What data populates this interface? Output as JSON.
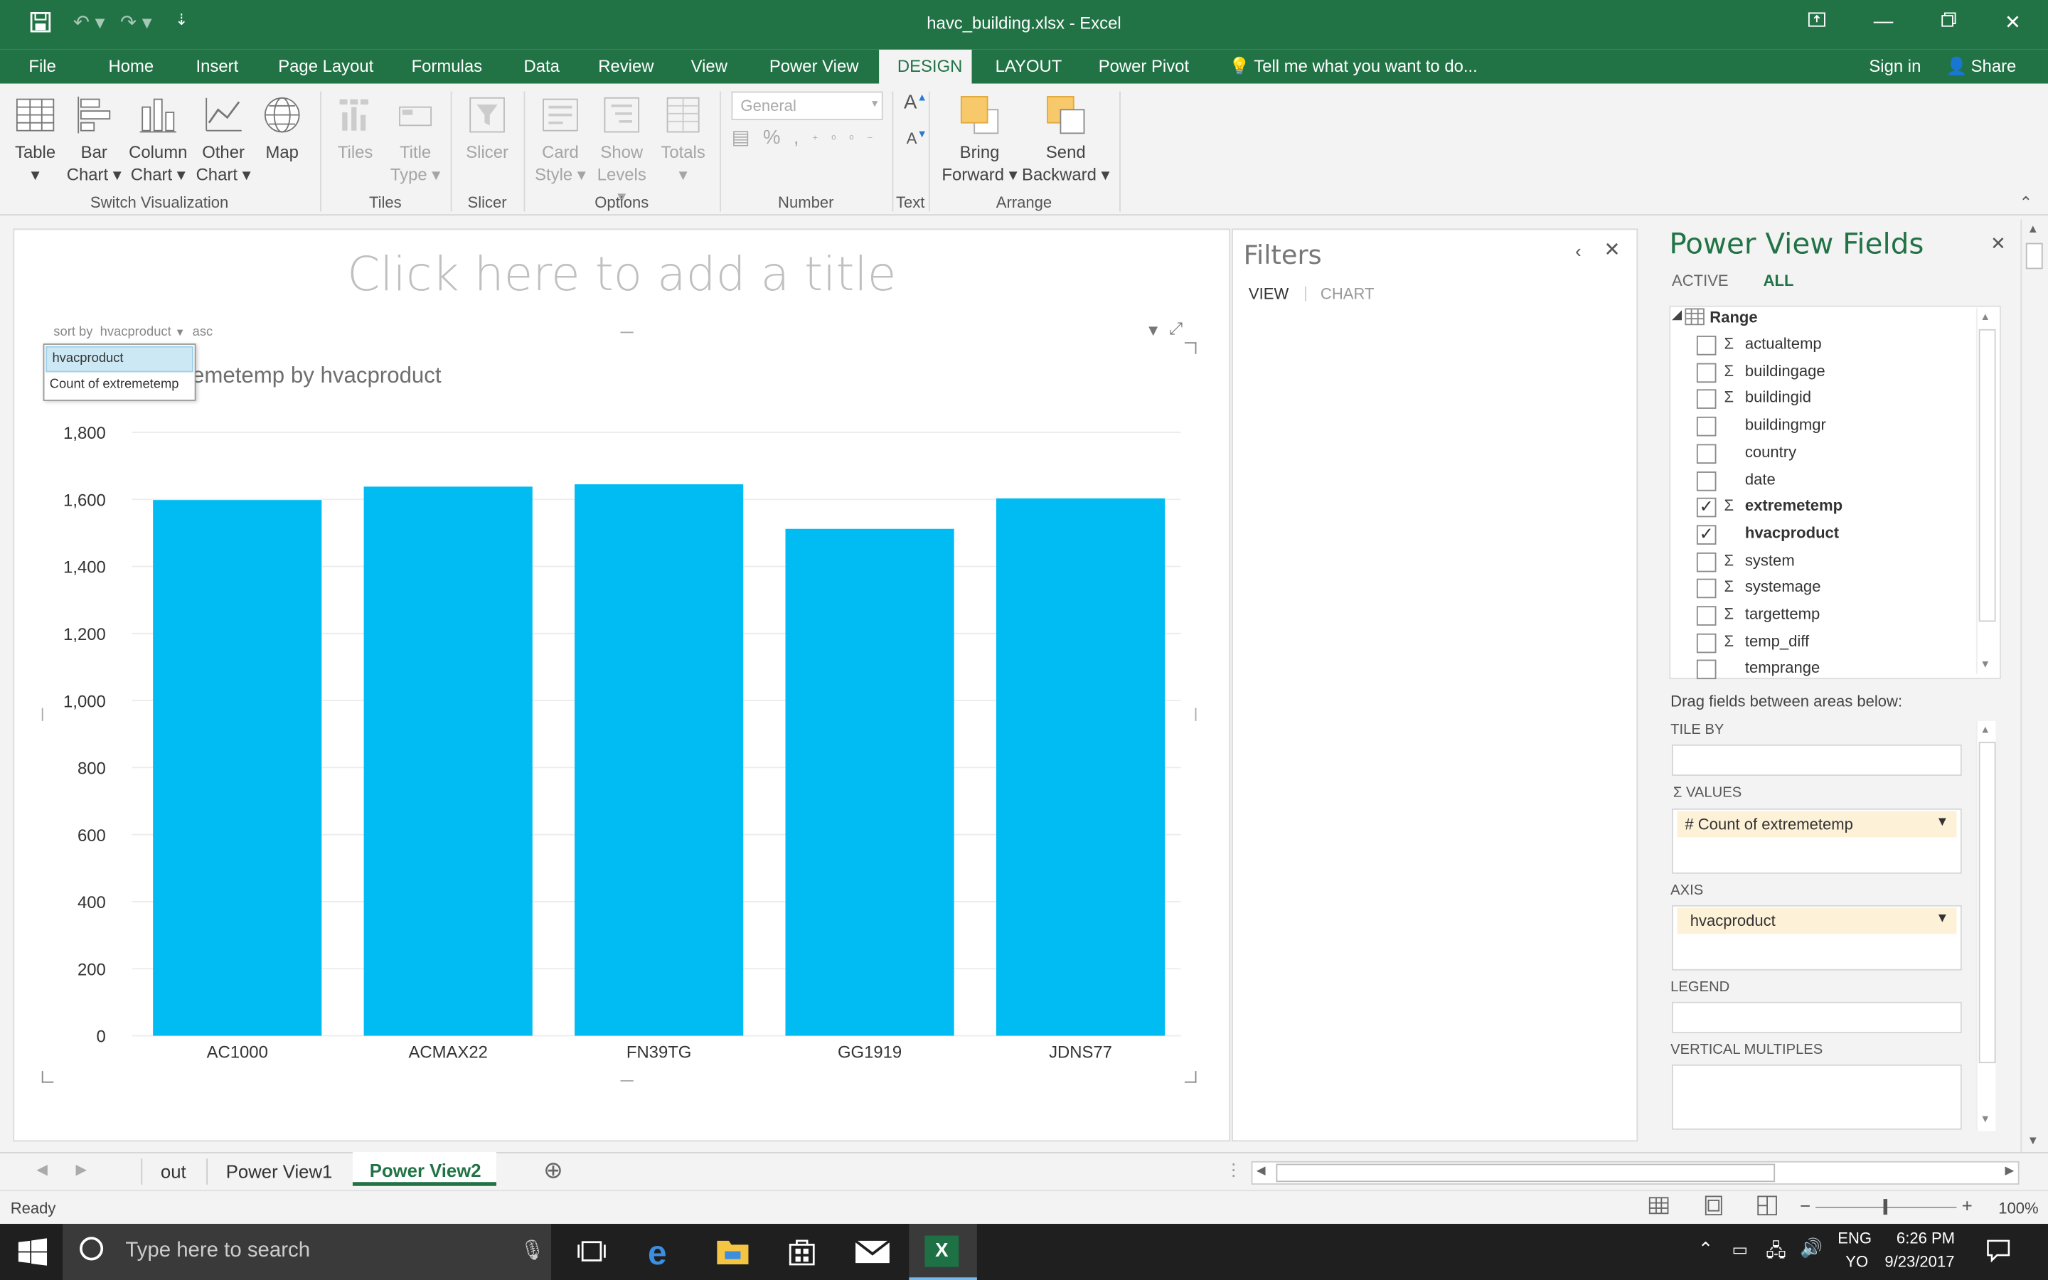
{
  "titlebar": {
    "title": "havc_building.xlsx - Excel"
  },
  "tabs": [
    "File",
    "Home",
    "Insert",
    "Page Layout",
    "Formulas",
    "Data",
    "Review",
    "View",
    "Power View",
    "DESIGN",
    "LAYOUT",
    "Power Pivot"
  ],
  "tell_me": "Tell me what you want to do...",
  "sign_in": "Sign in",
  "share": "Share",
  "ribbon": {
    "table": "Table",
    "bar1": "Bar",
    "bar2": "Chart",
    "column1": "Column",
    "column2": "Chart",
    "other1": "Other",
    "other2": "Chart",
    "map": "Map",
    "switch_group": "Switch Visualization",
    "tiles": "Tiles",
    "tile_type1": "Title",
    "tile_type2": "Type",
    "tiles_group": "Tiles",
    "slicer": "Slicer",
    "slicer_group": "Slicer",
    "card1": "Card",
    "card2": "Style",
    "levels1": "Show",
    "levels2": "Levels",
    "totals": "Totals",
    "options_group": "Options",
    "number_format": "General",
    "number_group": "Number",
    "text_group": "Text",
    "bring1": "Bring",
    "bring2": "Forward",
    "send1": "Send",
    "send2": "Backward",
    "arrange_group": "Arrange"
  },
  "canvas": {
    "title_placeholder": "Click here to add a title",
    "sort_by": "sort by",
    "sort_field": "hvacproduct",
    "sort_order": "asc",
    "sort_options": [
      "hvacproduct",
      "Count of extremetemp"
    ],
    "chart_title_visible": "emetemp by hvacproduct"
  },
  "chart_data": {
    "type": "bar",
    "title": "Count of extremetemp by hvacproduct",
    "categories": [
      "AC1000",
      "ACMAX22",
      "FN39TG",
      "GG1919",
      "JDNS77"
    ],
    "values": [
      1598,
      1638,
      1645,
      1512,
      1603
    ],
    "ylim": [
      0,
      1800
    ],
    "yticks": [
      0,
      200,
      400,
      600,
      800,
      1000,
      1200,
      1400,
      1600,
      1800
    ],
    "ytick_labels": [
      "0",
      "200",
      "400",
      "600",
      "800",
      "1,000",
      "1,200",
      "1,400",
      "1,600",
      "1,800"
    ],
    "bar_color": "#00bcf2",
    "grid": true
  },
  "filters": {
    "title": "Filters",
    "view": "VIEW",
    "chart": "CHART"
  },
  "fields": {
    "title": "Power View Fields",
    "active": "ACTIVE",
    "all": "ALL",
    "table": "Range",
    "items": [
      {
        "name": "actualtemp",
        "sigma": true,
        "checked": false
      },
      {
        "name": "buildingage",
        "sigma": true,
        "checked": false
      },
      {
        "name": "buildingid",
        "sigma": true,
        "checked": false
      },
      {
        "name": "buildingmgr",
        "sigma": false,
        "checked": false
      },
      {
        "name": "country",
        "sigma": false,
        "checked": false
      },
      {
        "name": "date",
        "sigma": false,
        "checked": false
      },
      {
        "name": "extremetemp",
        "sigma": true,
        "checked": true
      },
      {
        "name": "hvacproduct",
        "sigma": false,
        "checked": true
      },
      {
        "name": "system",
        "sigma": true,
        "checked": false
      },
      {
        "name": "systemage",
        "sigma": true,
        "checked": false
      },
      {
        "name": "targettemp",
        "sigma": true,
        "checked": false
      },
      {
        "name": "temp_diff",
        "sigma": true,
        "checked": false
      },
      {
        "name": "temprange",
        "sigma": false,
        "checked": false
      }
    ],
    "drag_hint": "Drag fields between areas below:",
    "tile_by": "TILE BY",
    "values_label": "VALUES",
    "values_item": "# Count of extremetemp",
    "axis_label": "AXIS",
    "axis_item": "hvacproduct",
    "legend_label": "LEGEND",
    "vertical_label": "VERTICAL MULTIPLES"
  },
  "sheets": [
    "out",
    "Power View1",
    "Power View2"
  ],
  "active_sheet": "Power View2",
  "status": {
    "ready": "Ready",
    "zoom": "100%"
  },
  "taskbar": {
    "search": "Type here to search",
    "lang1": "ENG",
    "lang2": "YO",
    "time": "6:26 PM",
    "date": "9/23/2017"
  }
}
